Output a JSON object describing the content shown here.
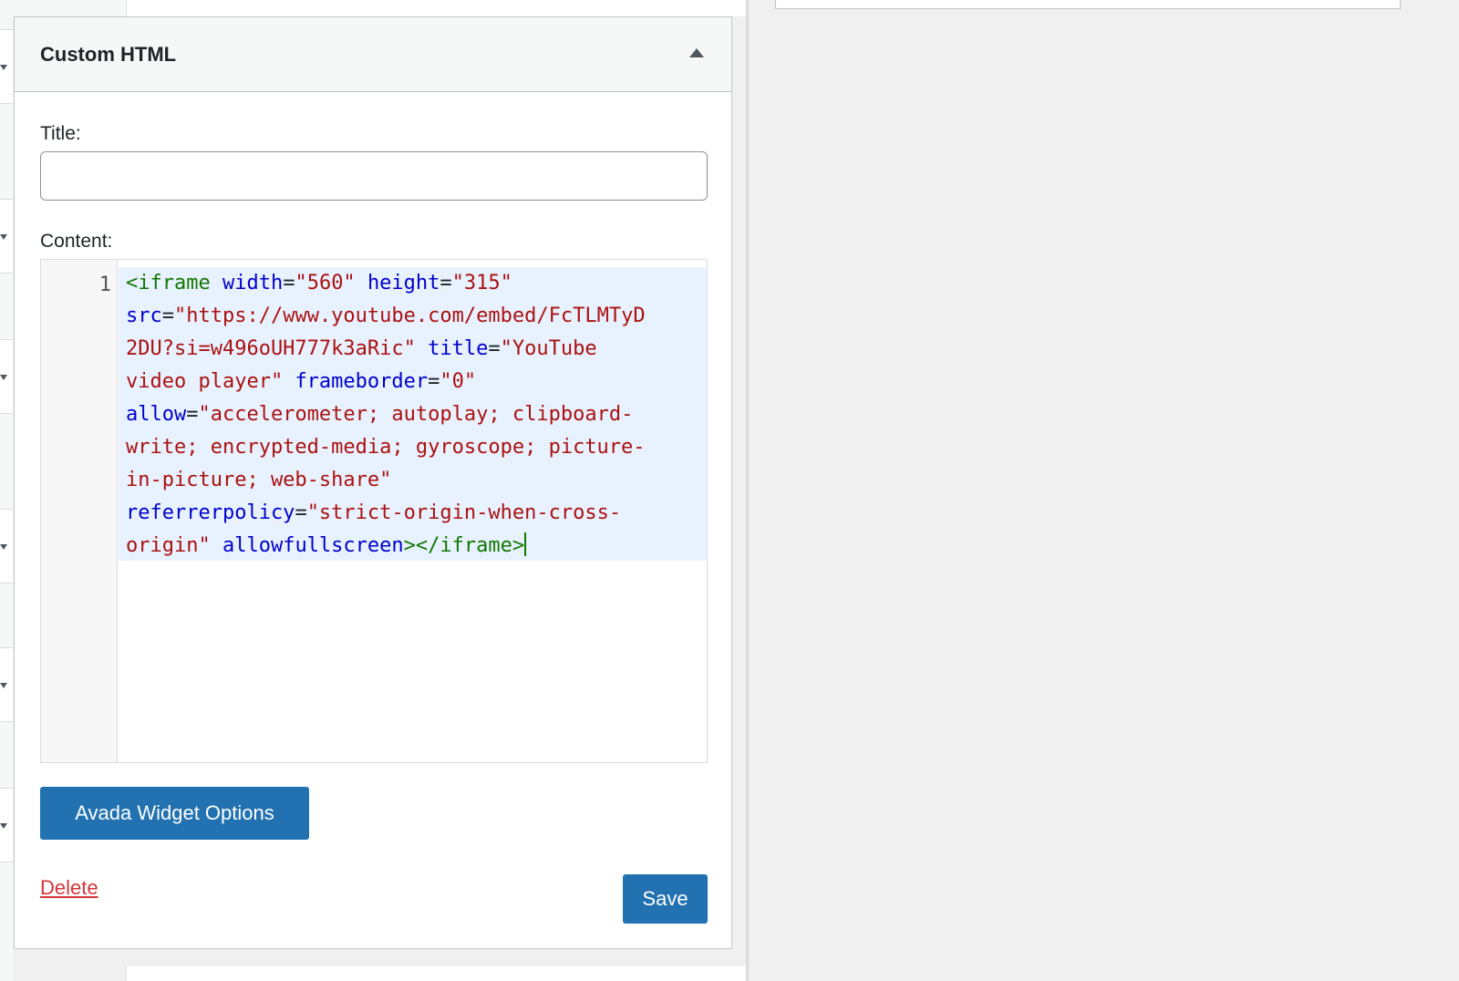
{
  "widget": {
    "title": "Custom HTML",
    "toggle_icon": "triangle-up-icon"
  },
  "form": {
    "title_label": "Title:",
    "title_value": "",
    "content_label": "Content:"
  },
  "editor": {
    "line_numbers": [
      "1"
    ],
    "code_text": "<iframe width=\"560\" height=\"315\" src=\"https://www.youtube.com/embed/FcTLMTyD2DU?si=w496oUH777k3aRic\" title=\"YouTube video player\" frameborder=\"0\" allow=\"accelerometer; autoplay; clipboard-write; encrypted-media; gyroscope; picture-in-picture; web-share\" referrerpolicy=\"strict-origin-when-cross-origin\" allowfullscreen></iframe>",
    "tokens": {
      "open_tag": "<iframe",
      "attr_width": "width",
      "val_width": "\"560\"",
      "attr_height": "height",
      "val_height": "\"315\"",
      "attr_src": "src",
      "val_src_line1": "\"https://www.youtube.com/embed/FcTLMTyD",
      "val_src_line2": "2DU?si=w496oUH777k3aRic\"",
      "attr_title": "title",
      "val_title_line1": "\"YouTube",
      "val_title_line2": "video player\"",
      "attr_frameborder": "frameborder",
      "val_frameborder": "\"0\"",
      "attr_allow": "allow",
      "val_allow_line1": "\"accelerometer; autoplay; clipboard-",
      "val_allow_line2": "write; encrypted-media; gyroscope; picture-",
      "val_allow_line3": "in-picture; web-share\"",
      "attr_referrerpolicy": "referrerpolicy",
      "val_referrerpolicy_line1": "\"strict-origin-when-cross-",
      "val_referrerpolicy_line2": "origin\"",
      "attr_allowfullscreen": "allowfullscreen",
      "close_tag": "></iframe>",
      "equals": "="
    }
  },
  "actions": {
    "options_label": "Avada Widget Options",
    "delete_label": "Delete",
    "save_label": "Save"
  },
  "colors": {
    "primary_button": "#2271b1",
    "delete_link": "#d63638",
    "code_tag": "#117700",
    "code_attribute": "#0000cc",
    "code_string": "#aa1111",
    "selection_bg": "#e8f2fe"
  }
}
